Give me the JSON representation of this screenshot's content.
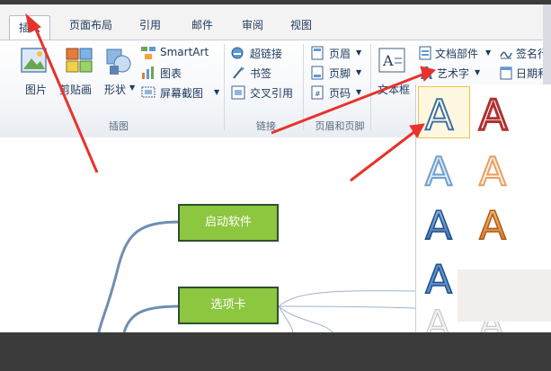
{
  "ribbon": {
    "tabs": [
      "插入",
      "页面布局",
      "引用",
      "邮件",
      "审阅",
      "视图"
    ],
    "active_tab": "插入",
    "illustrations": {
      "picture": "图片",
      "clipart": "剪贴画",
      "shapes": "形状",
      "smartart": "SmartArt",
      "chart": "图表",
      "screenshot": "屏幕截图",
      "group_label": "插图"
    },
    "links": {
      "hyperlink": "超链接",
      "bookmark": "书签",
      "crossref": "交叉引用",
      "group_label": "链接"
    },
    "header_footer": {
      "header": "页眉",
      "footer": "页脚",
      "page_number": "页码",
      "group_label": "页眉和页脚"
    },
    "text": {
      "textbox": "文本框",
      "quickparts": "文档部件",
      "wordart": "艺术字",
      "signature": "签名行",
      "datetime": "日期和时间"
    }
  },
  "mindmap": {
    "node1": "启动软件",
    "node2": "选项卡"
  },
  "gallery": {
    "glyph": "A"
  },
  "colors": {
    "node_fill": "#8dc63f",
    "arrow": "#e8322b",
    "branch_line": "#6f8fb0",
    "ribbon_text": "#1e395b"
  }
}
